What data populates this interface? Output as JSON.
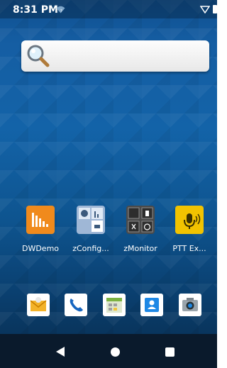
{
  "status_bar": {
    "time": "8:31 PM"
  },
  "apps": [
    {
      "label": "DWDemo"
    },
    {
      "label": "zConfig..."
    },
    {
      "label": "zMonitor"
    },
    {
      "label": "PTT Ex..."
    }
  ],
  "dock": [
    {
      "icon": "email-icon"
    },
    {
      "icon": "phone-icon"
    },
    {
      "icon": "calendar-icon"
    },
    {
      "icon": "contacts-icon"
    },
    {
      "icon": "camera-icon"
    }
  ],
  "colors": {
    "dwdemo": "#f08a1c",
    "ptt": "#f2c300",
    "zmonitor": "#4a4a4a",
    "zconfig": "#9fb7d6"
  }
}
